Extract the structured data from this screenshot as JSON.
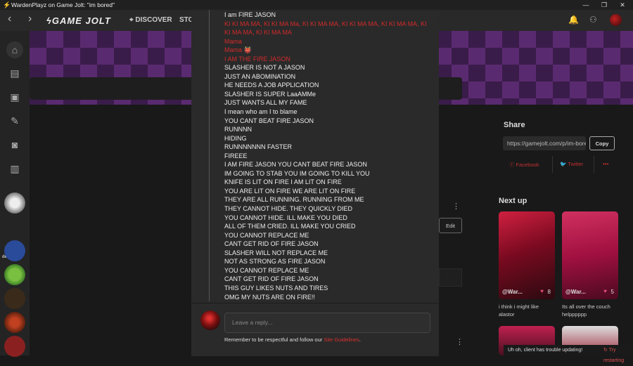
{
  "window": {
    "title": "WardenPlayz on Game Jolt: \"im bored\"",
    "controls": {
      "minimize": "—",
      "restore": "❐",
      "close": "✕"
    }
  },
  "topbar": {
    "back": "‹",
    "forward": "›",
    "logo": "GAME JOLT",
    "discover": "DISCOVER",
    "store_partial": "STO"
  },
  "sidebar": {
    "items": [
      "home-icon",
      "store-icon",
      "backpack-icon",
      "brush-icon",
      "chat-icon",
      "library-icon"
    ],
    "community_label": "deltarune"
  },
  "share": {
    "title": "Share",
    "url": "https://gamejolt.com/p/im-bored",
    "copy_label": "Copy",
    "facebook": "Facebook",
    "twitter": "Twitter",
    "more": "•••"
  },
  "post": {
    "edit_label": "Edit",
    "more": "⋮"
  },
  "next_up": {
    "title": "Next up",
    "cards": [
      {
        "user": "@War...",
        "likes": "8",
        "caption": "i think i might like alastor"
      },
      {
        "user": "@War...",
        "likes": "5",
        "caption": "Its all over the couch helpppppp"
      }
    ]
  },
  "toast": {
    "message": "Uh oh, client has trouble updating!",
    "link": "Try restarting"
  },
  "comment": {
    "lines": [
      {
        "text": "I am FIRE JASON",
        "red": false
      },
      {
        "text": "KI KI MA MA, KI KI MA Ma, KI KI MA MA, KI KI MA MA, KI KI MA MA, KI KI MA MA, KI KI MA MA",
        "red": true
      },
      {
        "text": "Mama",
        "red": true
      },
      {
        "text": "Mama 👹",
        "red": true
      },
      {
        "text": "I AM THE FIRE JASON",
        "red": true
      },
      {
        "text": "SLASHER IS NOT A JASON",
        "red": false
      },
      {
        "text": "JUST AN ABOMINATION",
        "red": false
      },
      {
        "text": "HE NEEDS A JOB APPLICATION",
        "red": false
      },
      {
        "text": "SLASHER IS SUPER LaaAMMe",
        "red": false
      },
      {
        "text": "JUST WANTS ALL MY FAME",
        "red": false
      },
      {
        "text": "I mean who am I to blame",
        "red": false
      },
      {
        "text": "YOU CANT BEAT FIRE JASON",
        "red": false
      },
      {
        "text": "RUNNNN",
        "red": false
      },
      {
        "text": "HIDING",
        "red": false
      },
      {
        "text": "RUNNNNNNN FASTER",
        "red": false
      },
      {
        "text": "FIREEE",
        "red": false
      },
      {
        "text": "I AM FIRE JASON YOU CANT BEAT FIRE JASON",
        "red": false
      },
      {
        "text": "IM GOING TO STAB YOU IM GOING TO KILL YOU",
        "red": false
      },
      {
        "text": "KNIFE IS LIT ON FIRE I AM LIT ON FIRE",
        "red": false
      },
      {
        "text": "YOU ARE LIT ON FIRE WE ARE LIT ON FIRE",
        "red": false
      },
      {
        "text": "THEY ARE ALL RUNNING. RUNNING FROM ME",
        "red": false
      },
      {
        "text": "THEY CANNOT HIDE. THEY QUICKLY DIED",
        "red": false
      },
      {
        "text": "YOU CANNOT HIDE. ILL MAKE YOU DIED",
        "red": false
      },
      {
        "text": "ALL OF THEM CRIED. ILL MAKE YOU CRIED",
        "red": false
      },
      {
        "text": "YOU CANNOT REPLACE ME",
        "red": false
      },
      {
        "text": "CANT GET RID OF FIRE JASON",
        "red": false
      },
      {
        "text": "SLASHER WILL NOT REPLACE ME",
        "red": false
      },
      {
        "text": "NOT AS STRONG AS FIRE JASON",
        "red": false
      },
      {
        "text": "YOU CANNOT REPLACE ME",
        "red": false
      },
      {
        "text": "CANT GET RID OF FIRE JASON",
        "red": false
      },
      {
        "text": "THIS GUY LIKES NUTS AND TIRES",
        "red": false
      },
      {
        "text": "OMG MY NUTS ARE ON FIRE!!",
        "red": false
      }
    ],
    "reply_placeholder": "Leave a reply...",
    "guidelines_prefix": "Remember to be respectful and follow our ",
    "guidelines_link": "Site Guidelines",
    "guidelines_suffix": "."
  },
  "colors": {
    "accent_red": "#d12a2a",
    "banner_purple": "#5a2a70"
  }
}
